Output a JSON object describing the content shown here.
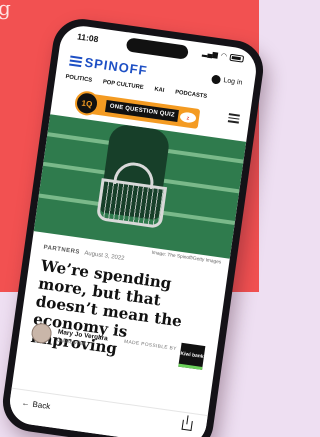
{
  "status": {
    "time": "11:08",
    "signal": "▂▄▆",
    "wifi": "◠"
  },
  "header": {
    "logo": "SPINOFF",
    "login_label": "Log in"
  },
  "nav": {
    "items": [
      "POLITICS",
      "POP CULTURE",
      "KAI",
      "PODCASTS"
    ]
  },
  "promo": {
    "badge": "1Q",
    "title": "ONE QUESTION QUIZ",
    "sponsor": "Z"
  },
  "article": {
    "image_credit": "Image: The Spinoff/Getty Images",
    "category": "PARTNERS",
    "date": "August 3, 2022",
    "headline": "We’re spending more, but that doesn’t mean the economy is improving",
    "author_name": "Mary Jo Vergara",
    "author_role": "Guest writer",
    "made_possible_label": "MADE POSSIBLE BY",
    "sponsor_logo_text": "Kiwi bank"
  },
  "toolbar": {
    "back_label": "Back"
  },
  "colors": {
    "background_top": "#f25151",
    "background_bottom": "#eedff2",
    "brand_blue": "#1d4fc4",
    "promo_orange": "#f49b22",
    "hero_green": "#2f7b4d"
  }
}
